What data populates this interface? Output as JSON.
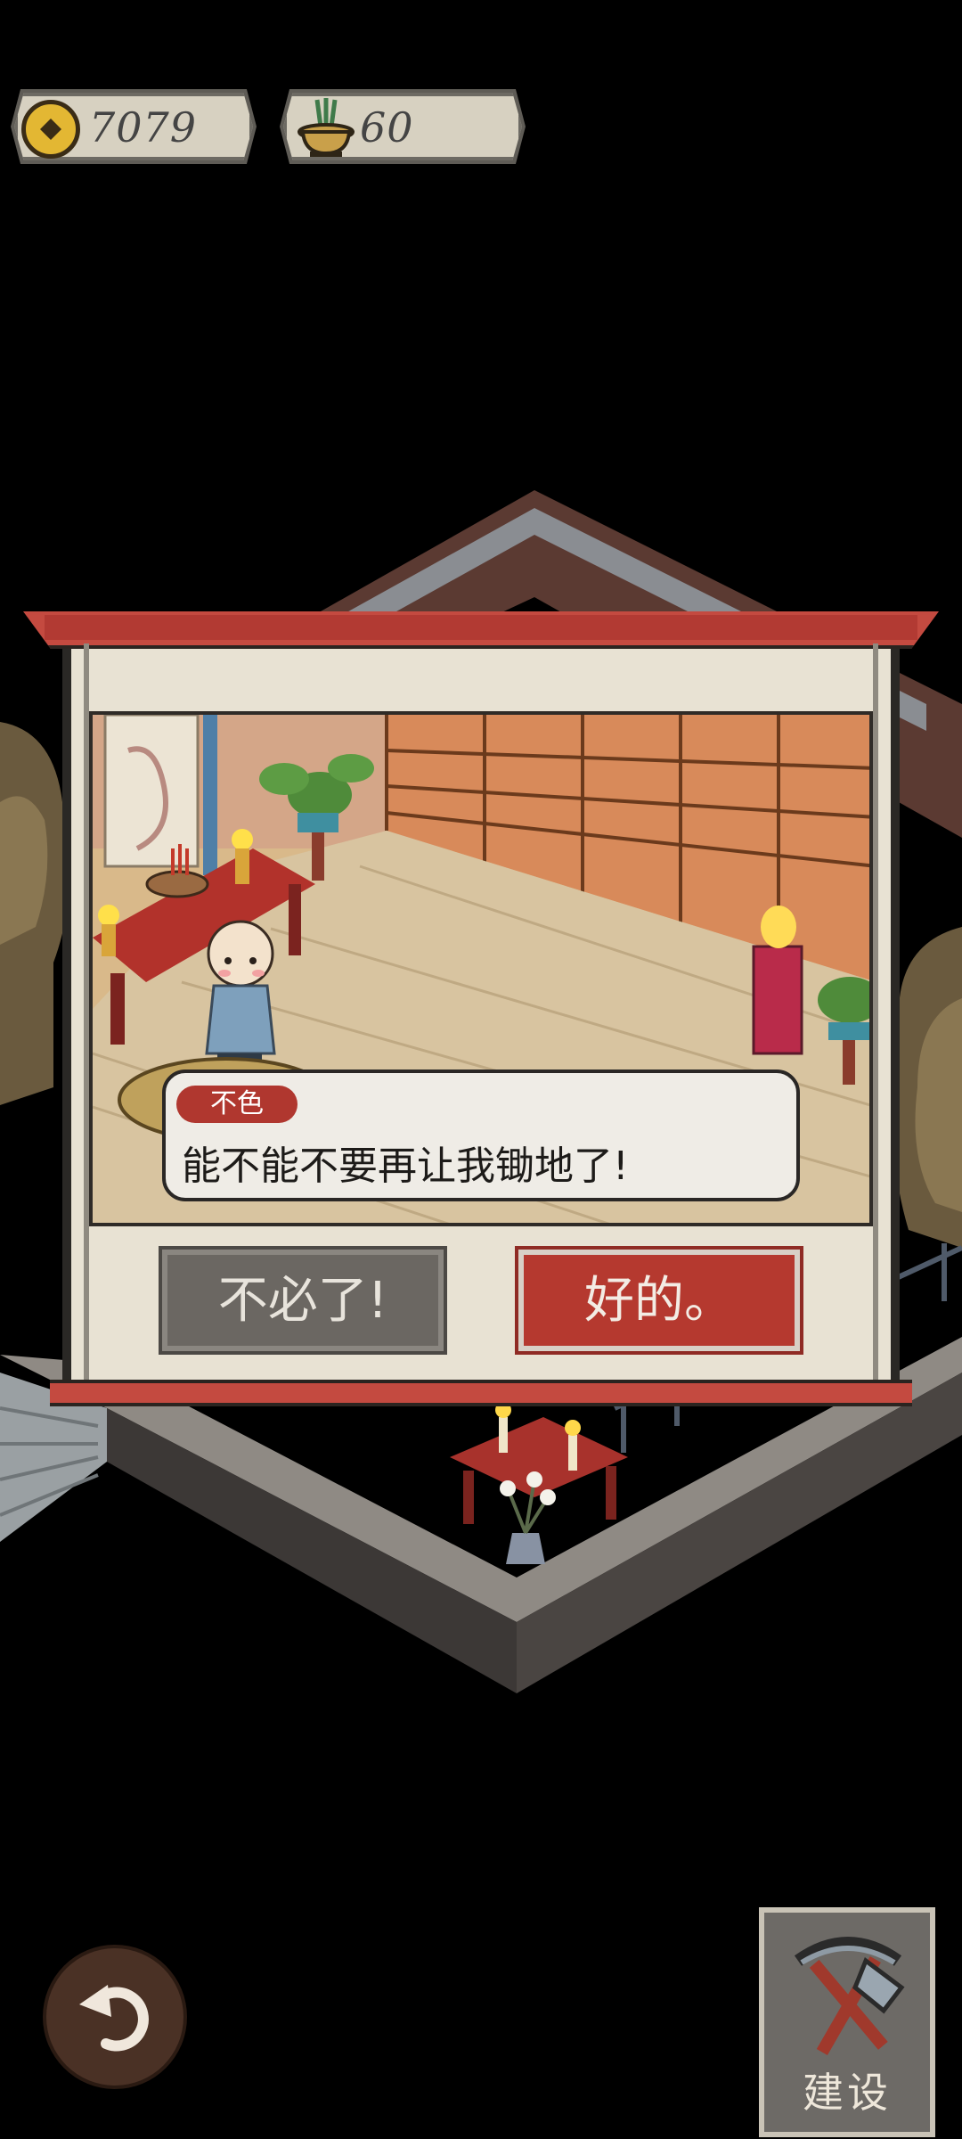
{
  "resources": {
    "coins": "7079",
    "incense": "60"
  },
  "dialog": {
    "speaker": "不色",
    "line": "能不能不要再让我锄地了!",
    "choices": {
      "decline": "不必了!",
      "accept": "好的。"
    }
  },
  "toolbar": {
    "build_label": "建设"
  },
  "icons": {
    "coin": "coin-icon",
    "incense": "incense-burner-icon",
    "back": "back-arrow-icon",
    "build": "pickaxe-shovel-icon"
  },
  "colors": {
    "accent_red": "#b5392f",
    "panel_bg": "#e8e2d3",
    "decline_gray": "#6b6762"
  }
}
